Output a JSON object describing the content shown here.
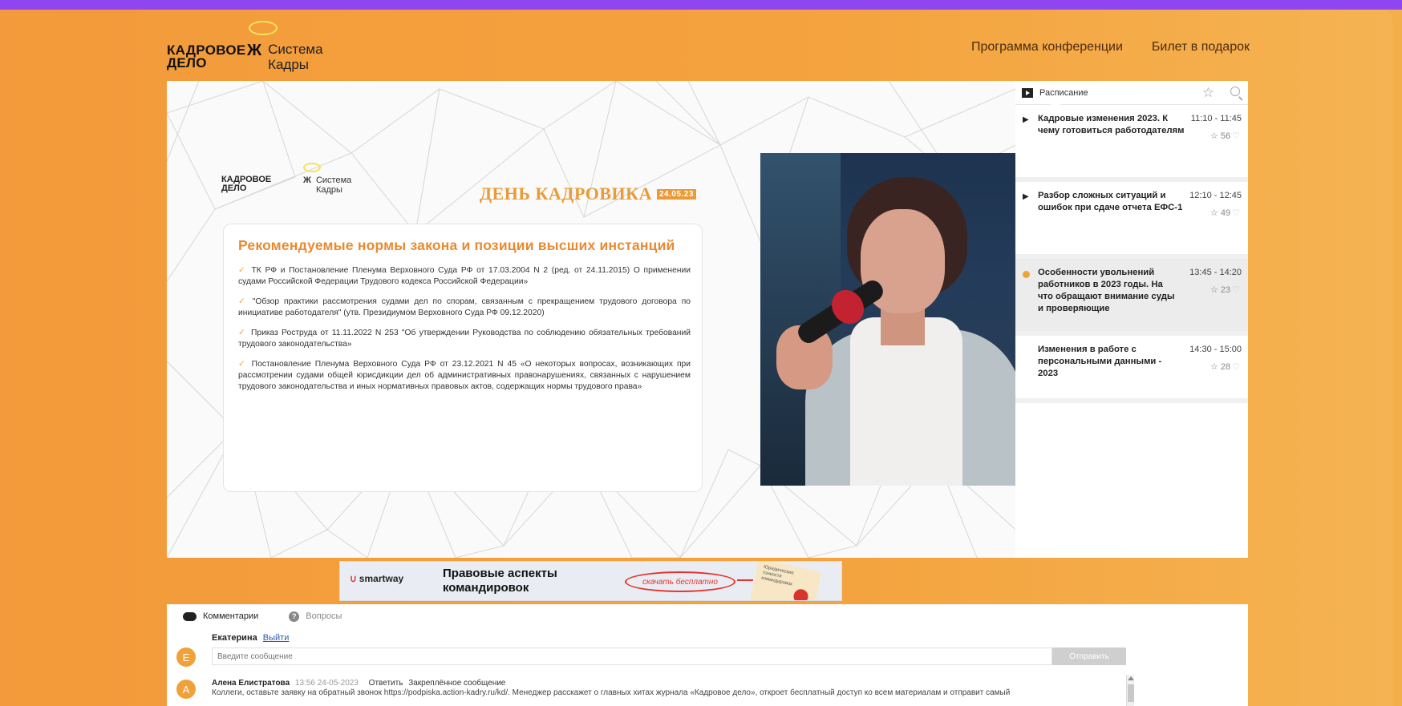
{
  "header": {
    "brand_kd": "КАДРОВОЕ ДЕЛО",
    "brand_sk_line1": "Система",
    "brand_sk_line2": "Кадры",
    "nav": [
      "Программа конференции",
      "Билет в подарок"
    ]
  },
  "slide": {
    "logo_kd": "КАДРОВОЕ ДЕЛО",
    "logo_sk_line1": "Система",
    "logo_sk_line2": "Кадры",
    "title": "ДЕНЬ КАДРОВИКА",
    "date": "24.05.23",
    "card_heading": "Рекомендуемые нормы закона и позиции высших инстанций",
    "items": [
      "ТК РФ и Постановление Пленума Верховного Суда РФ от 17.03.2004 N 2 (ред. от 24.11.2015) О применении судами Российской Федерации Трудового кодекса Российской Федерации»",
      "\"Обзор практики рассмотрения судами дел по спорам, связанным с прекращением трудового договора по инициативе работодателя\" (утв. Президиумом Верховного Суда РФ 09.12.2020)",
      "Приказ Роструда от 11.11.2022 N 253 \"Об утверждении Руководства по соблюдению обязательных требований трудового законодательства»",
      "Постановление Пленума Верховного Суда РФ от 23.12.2021 N 45 «О некоторых вопросах, возникающих при рассмотрении судами общей юрисдикции дел об административных правонарушениях, связанных с нарушением трудового законодательства и иных нормативных правовых актов, содержащих нормы трудового права»"
    ]
  },
  "schedule": {
    "title": "Расписание",
    "items": [
      {
        "title": "Кадровые изменения 2023. К чему готовиться работодателям",
        "time": "11:10 - 11:45",
        "likes": "56",
        "state": "play"
      },
      {
        "title": "Разбор сложных ситуаций и ошибок при сдаче отчета ЕФС-1",
        "time": "12:10 - 12:45",
        "likes": "49",
        "state": "play"
      },
      {
        "title": "Особенности увольнений работников в 2023 годы. На что обращают внимание суды и проверяющие",
        "time": "13:45 - 14:20",
        "likes": "23",
        "state": "live"
      },
      {
        "title": "Изменения в работе с персональными данными - 2023",
        "time": "14:30 - 15:00",
        "likes": "28",
        "state": "none"
      }
    ]
  },
  "banner": {
    "brand": "smartway",
    "headline_line1": "Правовые аспекты",
    "headline_line2": "командировок",
    "cta": "скачать бесплатно",
    "mag_text": "Юридические тонкости командировок"
  },
  "comments": {
    "tab_comments": "Комментарии",
    "tab_questions": "Вопросы",
    "user_name": "Екатерина",
    "logout": "Выйти",
    "user_initial": "Е",
    "input_placeholder": "Введите сообщение",
    "send_label": "Отправить",
    "list": [
      {
        "initial": "А",
        "name": "Алена Елистратова",
        "meta": "13:56 24-05-2023",
        "reply": "Ответить",
        "pinned": "Закреплённое сообщение",
        "text": "Коллеги, оставьте заявку на обратный звонок https://podpiska.action-kadry.ru/kd/. Менеджер расскажет о главных хитах журнала «Кадровое дело», откроет бесплатный доступ ко всем материалам и отправит самый"
      }
    ]
  },
  "colors": {
    "accent_orange": "#f0a13a",
    "purple_bar": "#8f45f0",
    "cta_red": "#e4342d"
  }
}
